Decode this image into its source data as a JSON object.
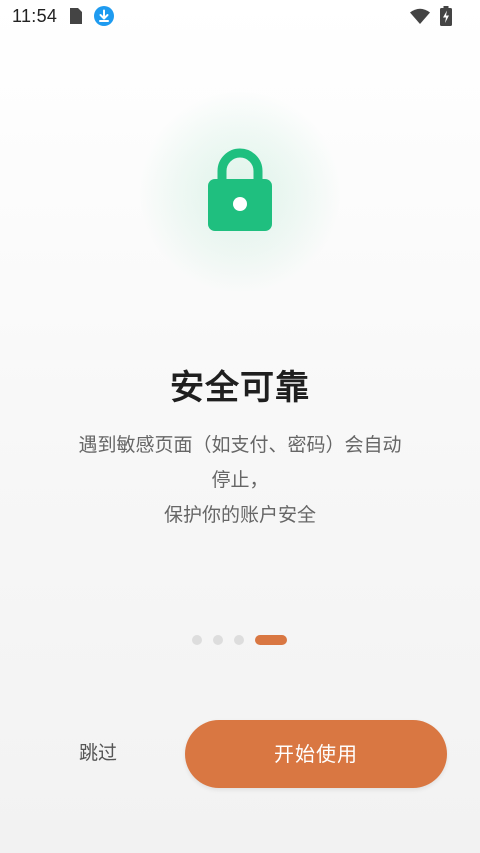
{
  "status_bar": {
    "time": "11:54",
    "icons": [
      "sim-card-icon",
      "download-icon",
      "wifi-icon",
      "battery-charging-icon"
    ]
  },
  "onboarding": {
    "icon": "lock-icon",
    "title": "安全可靠",
    "description_lines": [
      "遇到敏感页面（如支付、密码）会自动",
      "停止，",
      "保护你的账户安全"
    ],
    "page_indicator": {
      "total": 4,
      "current": 4
    }
  },
  "actions": {
    "skip_label": "跳过",
    "start_label": "开始使用"
  },
  "colors": {
    "accent": "#d97742",
    "lock_green": "#1fbf7f",
    "download_blue": "#1e9bf0"
  }
}
